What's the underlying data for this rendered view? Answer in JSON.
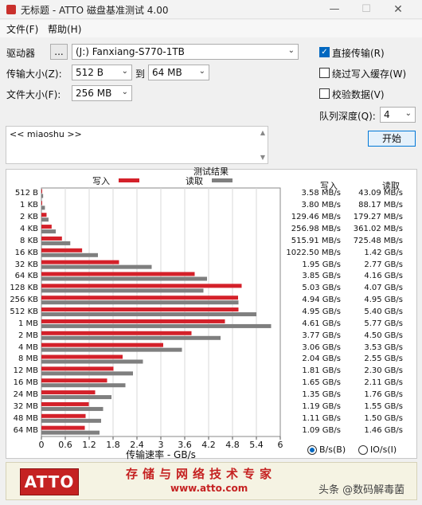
{
  "window": {
    "title": "无标题 - ATTO 磁盘基准测试 4.00",
    "min": "—",
    "max": "☐",
    "close": "✕"
  },
  "menu": {
    "file": "文件(F)",
    "help": "帮助(H)"
  },
  "controls": {
    "drive_label": "驱动器",
    "browse": "...",
    "drive": "(J:) Fanxiang-S770-1TB",
    "transfer_label": "传输大小(Z):",
    "transfer_from": "512 B",
    "to_label": "到",
    "transfer_to": "64 MB",
    "filesize_label": "文件大小(F):",
    "filesize": "256 MB",
    "direct_io": "直接传输(R)",
    "bypass_cache": "绕过写入缓存(W)",
    "verify": "校验数据(V)",
    "queue_label": "队列深度(Q):",
    "queue": "4",
    "start": "开始",
    "direct_io_checked": true,
    "bypass_checked": false,
    "verify_checked": false
  },
  "description": "<< miaoshu >>",
  "results": {
    "title": "测试结果",
    "write_legend": "写入",
    "read_legend": "读取",
    "col_write": "写入",
    "col_read": "读取",
    "write_color": "#d4212a",
    "read_color": "#7f7f7f"
  },
  "chart_data": {
    "type": "bar",
    "orientation": "horizontal",
    "categories": [
      "512 B",
      "1 KB",
      "2 KB",
      "4 KB",
      "8 KB",
      "16 KB",
      "32 KB",
      "64 KB",
      "128 KB",
      "256 KB",
      "512 KB",
      "1 MB",
      "2 MB",
      "4 MB",
      "8 MB",
      "12 MB",
      "16 MB",
      "24 MB",
      "32 MB",
      "48 MB",
      "64 MB"
    ],
    "series": [
      {
        "name": "写入",
        "values": [
          0.00358,
          0.0038,
          0.12946,
          0.25698,
          0.51591,
          1.0225,
          1.95,
          3.85,
          5.03,
          4.94,
          4.95,
          4.61,
          3.77,
          3.06,
          2.04,
          1.81,
          1.65,
          1.35,
          1.19,
          1.11,
          1.09
        ]
      },
      {
        "name": "读取",
        "values": [
          0.04309,
          0.08817,
          0.17927,
          0.36102,
          0.72548,
          1.42,
          2.77,
          4.16,
          4.07,
          4.95,
          5.4,
          5.77,
          4.5,
          3.53,
          2.55,
          2.3,
          2.11,
          1.76,
          1.55,
          1.5,
          1.46
        ]
      }
    ],
    "write_text": [
      "3.58 MB/s",
      "3.80 MB/s",
      "129.46 MB/s",
      "256.98 MB/s",
      "515.91 MB/s",
      "1022.50 MB/s",
      "1.95 GB/s",
      "3.85 GB/s",
      "5.03 GB/s",
      "4.94 GB/s",
      "4.95 GB/s",
      "4.61 GB/s",
      "3.77 GB/s",
      "3.06 GB/s",
      "2.04 GB/s",
      "1.81 GB/s",
      "1.65 GB/s",
      "1.35 GB/s",
      "1.19 GB/s",
      "1.11 GB/s",
      "1.09 GB/s"
    ],
    "read_text": [
      "43.09 MB/s",
      "88.17 MB/s",
      "179.27 MB/s",
      "361.02 MB/s",
      "725.48 MB/s",
      "1.42 GB/s",
      "2.77 GB/s",
      "4.16 GB/s",
      "4.07 GB/s",
      "4.95 GB/s",
      "5.40 GB/s",
      "5.77 GB/s",
      "4.50 GB/s",
      "3.53 GB/s",
      "2.55 GB/s",
      "2.30 GB/s",
      "2.11 GB/s",
      "1.76 GB/s",
      "1.55 GB/s",
      "1.50 GB/s",
      "1.46 GB/s"
    ],
    "xticks": [
      "0",
      "0.6",
      "1.2",
      "1.8",
      "2.4",
      "3",
      "3.6",
      "4.2",
      "4.8",
      "5.4",
      "6"
    ],
    "xlim": [
      0,
      6
    ],
    "xlabel": "传输速率 - GB/s",
    "grid": true
  },
  "units": {
    "bytes": "B/s(B)",
    "io": "IO/s(I)",
    "selected": "bytes"
  },
  "banner": {
    "logo": "ATTO",
    "slogan": "存储与网络技术专家",
    "url": "www.atto.com"
  },
  "watermark": "头条 @数码解毒菌"
}
